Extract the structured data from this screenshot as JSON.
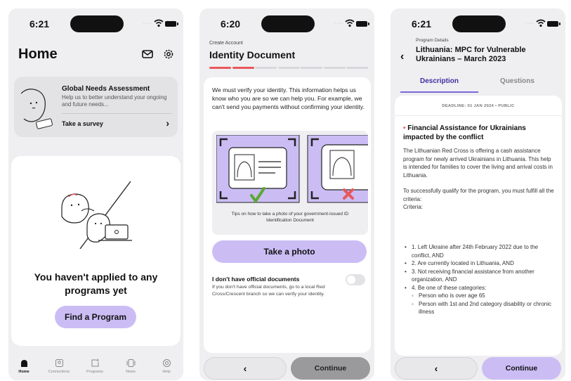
{
  "phone1": {
    "status": {
      "time": "6:21"
    },
    "title": "Home",
    "icons": {
      "mail": "mail-icon",
      "settings": "gear-icon"
    },
    "survey": {
      "title": "Global Needs Assessment",
      "description": "Help us to better understand your ongoing and future needs...",
      "link": "Take a survey",
      "chevron": "›"
    },
    "empty": {
      "message": "You haven't applied to any programs yet",
      "button": "Find a Program"
    },
    "tabs": [
      {
        "label": "Home",
        "icon": "home-icon",
        "active": true
      },
      {
        "label": "Connections",
        "icon": "connections-icon"
      },
      {
        "label": "Programs",
        "icon": "programs-icon"
      },
      {
        "label": "News",
        "icon": "news-icon"
      },
      {
        "label": "Help",
        "icon": "help-icon"
      }
    ]
  },
  "phone2": {
    "status": {
      "time": "6:20"
    },
    "breadcrumb": "Create Account",
    "title": "Identity Document",
    "progress": {
      "total_steps": 7,
      "completed_steps": 2,
      "done_color": "#e8585a"
    },
    "intro": "We must verify your identity. This information helps us know who you are so we can help you. For example, we can't send you payments without confirming your identity.",
    "caption_line1": "Tips on how to take a photo of your government-issued ID",
    "caption_line2": "Identification Document",
    "take_photo": "Take a photo",
    "no_docs_title": "I don't have official documents",
    "no_docs_desc": "If you don't have official documents, go to a local Red Cross/Crescent branch so we can verify your identity.",
    "back": "‹",
    "continue": "Continue"
  },
  "phone3": {
    "status": {
      "time": "6:21"
    },
    "breadcrumb": "Program Details",
    "title": "Lithuania: MPC for Vulnerable Ukrainians – March 2023",
    "back_arrow": "‹",
    "tabs": [
      "Description",
      "Questions"
    ],
    "meta": "DEADLINE: 01 JAN 2024  •  PUBLIC",
    "section_title": "Financial Assistance for Ukrainians impacted by the conflict",
    "para1": "The Lithuanian Red Cross is offering a cash assistance program for newly arrived Ukrainians in Lithuania. This help is intended for families to cover the living and arrival costs in Lithuania.",
    "para2": "To successfully qualify for the program, you must fulfill all the criteria:",
    "para3": "Criteria:",
    "criteria": [
      "1. Left Ukraine after 24th February 2022 due to the conflict, AND",
      "2. Are currently located in Lithuania, AND",
      "3. Not receiving financial assistance from another organization, AND",
      "4. Be one of these categories:"
    ],
    "sub_criteria": [
      "Person who is over age 65",
      "Person with 1st and 2nd category disability or chronic illness"
    ],
    "back": "‹",
    "continue": "Continue"
  },
  "colors": {
    "accent": "#cbbdf4",
    "accent_dark": "#3f2fa0",
    "red": "#e8585a",
    "green": "#5aa832"
  }
}
